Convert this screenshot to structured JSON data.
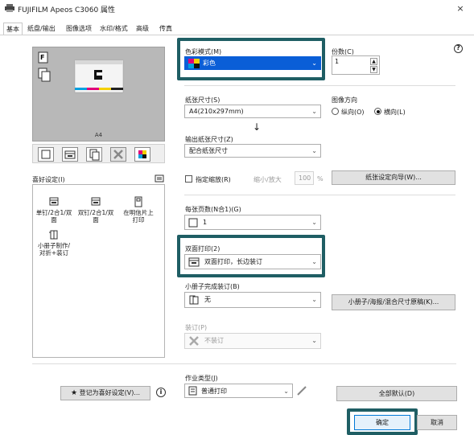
{
  "window": {
    "title": "FUJIFILM Apeos C3060 属性",
    "close_glyph": "×"
  },
  "tabs": [
    "基本",
    "纸盘/输出",
    "图像选项",
    "水印/格式",
    "高级",
    "传真"
  ],
  "preview": {
    "paper_label": "A4"
  },
  "favorites": {
    "label": "喜好设定(I)",
    "items": [
      {
        "line1": "单钉/2合1/双",
        "line2": "面"
      },
      {
        "line1": "双钉/2合1/双",
        "line2": "面"
      },
      {
        "line1": "在明信片上",
        "line2": "打印"
      },
      {
        "line1": "小册子制作/",
        "line2": "对折+装订"
      }
    ],
    "register_button": "登记为喜好设定(V)..."
  },
  "color_mode": {
    "label": "色彩模式(M)",
    "value": "彩色"
  },
  "copies": {
    "label": "份数(C)",
    "value": "1"
  },
  "paper_size": {
    "label": "纸张尺寸(S)",
    "value": "A4(210x297mm)"
  },
  "arrow_glyph": "↓",
  "output_size": {
    "label": "输出纸张尺寸(Z)",
    "value": "配合纸张尺寸"
  },
  "orientation": {
    "label": "图像方向",
    "portrait": "纵向(O)",
    "landscape": "横向(L)"
  },
  "scale": {
    "checkbox_label": "指定缩放(R)",
    "reduce_label": "缩小/放大",
    "value": "100",
    "unit": "%"
  },
  "paper_wizard_button": "纸张设定向导(W)...",
  "pages_per_sheet": {
    "label": "每张页数(N合1)(G)",
    "value": "1"
  },
  "duplex": {
    "label": "双面打印(2)",
    "value": "双面打印，长边装订"
  },
  "booklet": {
    "label": "小册子完成装订(B)",
    "value": "无",
    "button": "小册子/海报/混合尺寸原稿(K)..."
  },
  "staple": {
    "label": "装订(P)",
    "value": "不装订"
  },
  "job_type": {
    "label": "作业类型(J)",
    "value": "普通打印"
  },
  "defaults_button": "全部默认(D)",
  "ok_button": "确定",
  "cancel_button": "取消",
  "info_glyph": "i",
  "help_glyph": "?",
  "colors": {
    "highlight": "#1f5e64",
    "accent_blue": "#0a5ed7"
  }
}
